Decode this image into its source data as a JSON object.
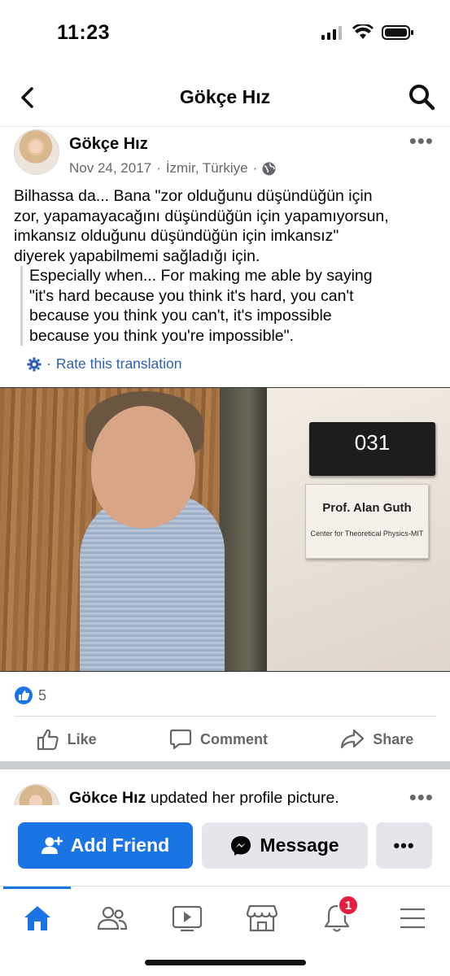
{
  "status_bar": {
    "time": "11:23"
  },
  "header": {
    "title": "Gökçe Hız"
  },
  "post": {
    "author": "Gökçe Hız",
    "date": "Nov 24, 2017",
    "location": "İzmir, Türkiye",
    "separator": "·",
    "text": "Bilhassa da... Bana \"zor olduğunu düşündüğün için\nzor, yapamayacağını düşündüğün için yapamıyorsun,\nimkansız olduğunu düşündüğün için imkansız\"\ndiyerek yapabilmemi sağladığı için.",
    "translation": "Especially when... For making me able by saying\n\"it's hard because you think it's hard, you can't\nbecause you think you can't, it's impossible\nbecause you think you're impossible\".",
    "rate_translation": "Rate this translation",
    "photo": {
      "room_number": "031",
      "name_sign": "Prof. Alan Guth",
      "name_sign_sub": "Center for Theoretical Physics-MIT"
    },
    "reaction_count": "5",
    "actions": {
      "like": "Like",
      "comment": "Comment",
      "share": "Share"
    }
  },
  "next_post": {
    "author": "Gökce Hız",
    "action_text": "updated her profile picture."
  },
  "cta": {
    "add_friend": "Add Friend",
    "message": "Message"
  },
  "bottom_nav": {
    "notifications_badge": "1"
  },
  "colors": {
    "accent": "#1b74e4",
    "badge": "#e41e3f",
    "link": "#2e5fb3"
  }
}
